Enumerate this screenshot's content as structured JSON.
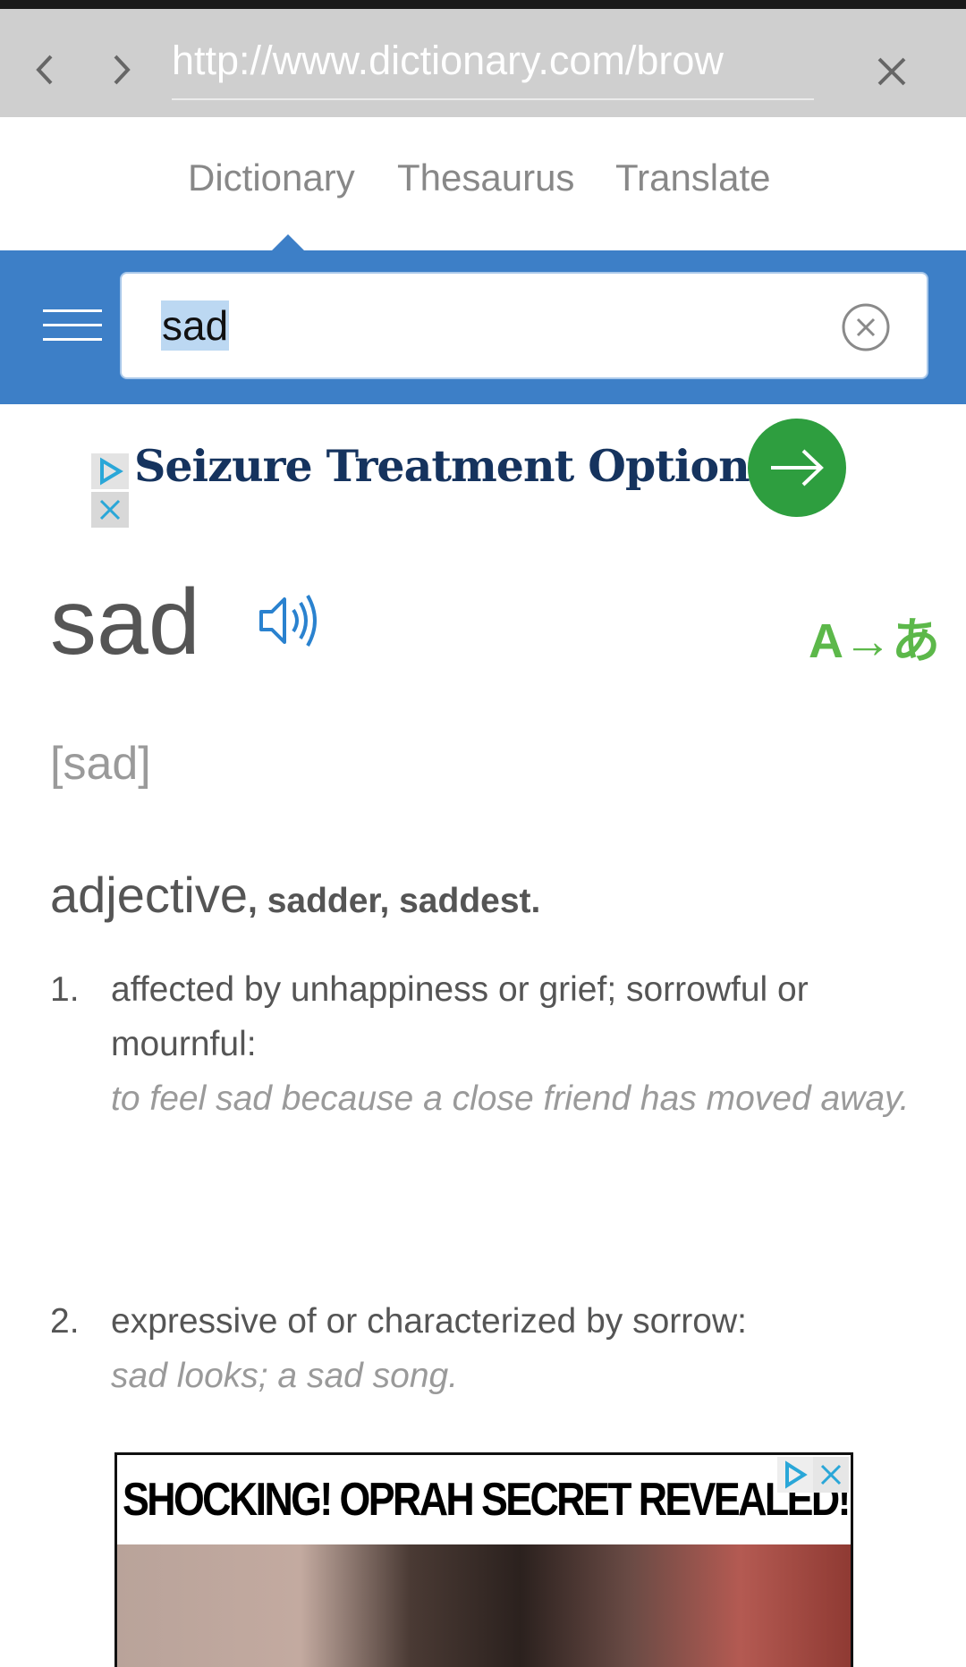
{
  "browser": {
    "url": "http://www.dictionary.com/brow",
    "back_icon": "chevron-left-icon",
    "forward_icon": "chevron-right-icon",
    "close_icon": "close-icon"
  },
  "tabs": [
    {
      "label": "Dictionary",
      "active": true
    },
    {
      "label": "Thesaurus",
      "active": false
    },
    {
      "label": "Translate",
      "active": false
    }
  ],
  "search": {
    "value": "sad",
    "menu_icon": "hamburger-menu-icon",
    "clear_icon": "clear-circle-icon"
  },
  "ad_top": {
    "headline": "Seizure Treatment Options »",
    "adchoices_icon": "adchoices-icon",
    "close_icon": "close-icon",
    "go_icon": "arrow-right-icon"
  },
  "entry": {
    "word": "sad",
    "audio_icon": "speaker-icon",
    "translate_label": "A→あ",
    "pronunciation": "[sad]",
    "part_of_speech": "adjective",
    "inflections": ", sadder, saddest.",
    "definitions": [
      {
        "number": "1.",
        "text": "affected by unhappiness or grief; sorrowful or mournful:",
        "example": "to feel sad because a close friend has moved away."
      },
      {
        "number": "2.",
        "text": "expressive of or characterized by sorrow:",
        "example": "sad looks; a sad song."
      }
    ]
  },
  "ad_bottom": {
    "headline": "SHOCKING! OPRAH SECRET REVEALED!",
    "adchoices_icon": "adchoices-icon",
    "close_icon": "close-icon"
  },
  "colors": {
    "brand_blue": "#3d7fc7",
    "browser_bar": "#cfcfcf",
    "ad_green": "#2e9e3f",
    "translate_green": "#5cb84a",
    "ad_navy": "#15335e"
  }
}
